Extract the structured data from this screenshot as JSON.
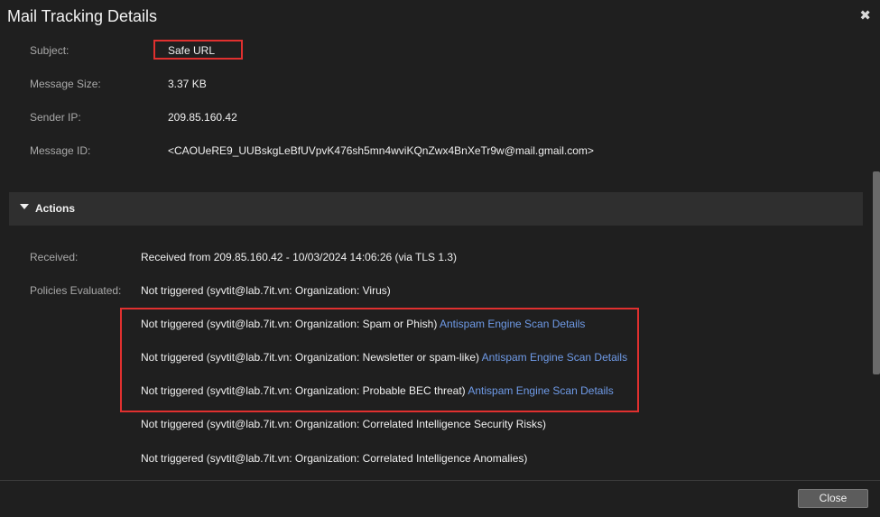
{
  "dialog": {
    "title": "Mail Tracking Details",
    "close_glyph": "✖"
  },
  "details": {
    "subject_label": "Subject:",
    "subject_value": "Safe URL",
    "size_label": "Message Size:",
    "size_value": "3.37 KB",
    "ip_label": "Sender IP:",
    "ip_value": "209.85.160.42",
    "id_label": "Message ID:",
    "id_value": "<CAOUeRE9_UUBskgLeBfUVpvK476sh5mn4wviKQnZwx4BnXeTr9w@mail.gmail.com>"
  },
  "actions": {
    "header": "Actions",
    "received_label": "Received:",
    "received_value": "Received from 209.85.160.42 - 10/03/2024 14:06:26 (via TLS 1.3)",
    "policies_label": "Policies Evaluated:",
    "policies": [
      {
        "text": "Not triggered (syvtit@lab.7it.vn: Organization: Virus)",
        "link": ""
      },
      {
        "text": "Not triggered (syvtit@lab.7it.vn: Organization: Spam or Phish)",
        "link": "Antispam Engine Scan Details"
      },
      {
        "text": "Not triggered (syvtit@lab.7it.vn: Organization: Newsletter or spam-like)",
        "link": "Antispam Engine Scan Details"
      },
      {
        "text": "Not triggered (syvtit@lab.7it.vn: Organization: Probable BEC threat)",
        "link": "Antispam Engine Scan Details"
      },
      {
        "text": "Not triggered (syvtit@lab.7it.vn: Organization: Correlated Intelligence Security Risks)",
        "link": ""
      },
      {
        "text": "Not triggered (syvtit@lab.7it.vn: Organization: Correlated Intelligence Anomalies)",
        "link": ""
      }
    ]
  },
  "footer": {
    "close_label": "Close"
  },
  "colors": {
    "highlight": "#e0302f",
    "link": "#6f9be8",
    "background": "#1f1f1f"
  }
}
